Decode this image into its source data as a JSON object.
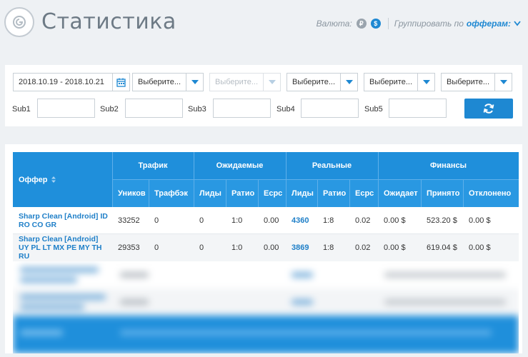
{
  "header": {
    "title": "Статистика",
    "currency_label": "Валюта:",
    "currency_rub": "₽",
    "currency_usd": "$",
    "group_label": "Группировать по",
    "group_value": "офферам:"
  },
  "filters": {
    "date_range": "2018.10.19 - 2018.10.21",
    "selects": [
      {
        "label": "Выберите..."
      },
      {
        "label": "Выберите..."
      },
      {
        "label": "Выберите..."
      },
      {
        "label": "Выберите..."
      },
      {
        "label": "Выберите..."
      }
    ],
    "subs": [
      "Sub1",
      "Sub2",
      "Sub3",
      "Sub4",
      "Sub5"
    ]
  },
  "table": {
    "offer_header": "Оффер",
    "groups": [
      "Трафик",
      "Ожидаемые",
      "Реальные",
      "Финансы"
    ],
    "columns": [
      "Уников",
      "Трафбэк",
      "Лиды",
      "Ратио",
      "Ecpc",
      "Лиды",
      "Ратио",
      "Ecpc",
      "Ожидает",
      "Принято",
      "Отклонено"
    ],
    "rows": [
      {
        "offer": "Sharp Clean [Android] ID RO CO GR",
        "cells": [
          "33252",
          "0",
          "0",
          "1:0",
          "0.00",
          "4360",
          "1:8",
          "0.02",
          "0.00 $",
          "523.20 $",
          "0.00 $"
        ]
      },
      {
        "offer": "Sharp Clean [Android] UY PL LT MX PE MY TH RU",
        "cells": [
          "29353",
          "0",
          "0",
          "1:0",
          "0.00",
          "3869",
          "1:8",
          "0.02",
          "0.00 $",
          "619.04 $",
          "0.00 $"
        ]
      }
    ]
  }
}
